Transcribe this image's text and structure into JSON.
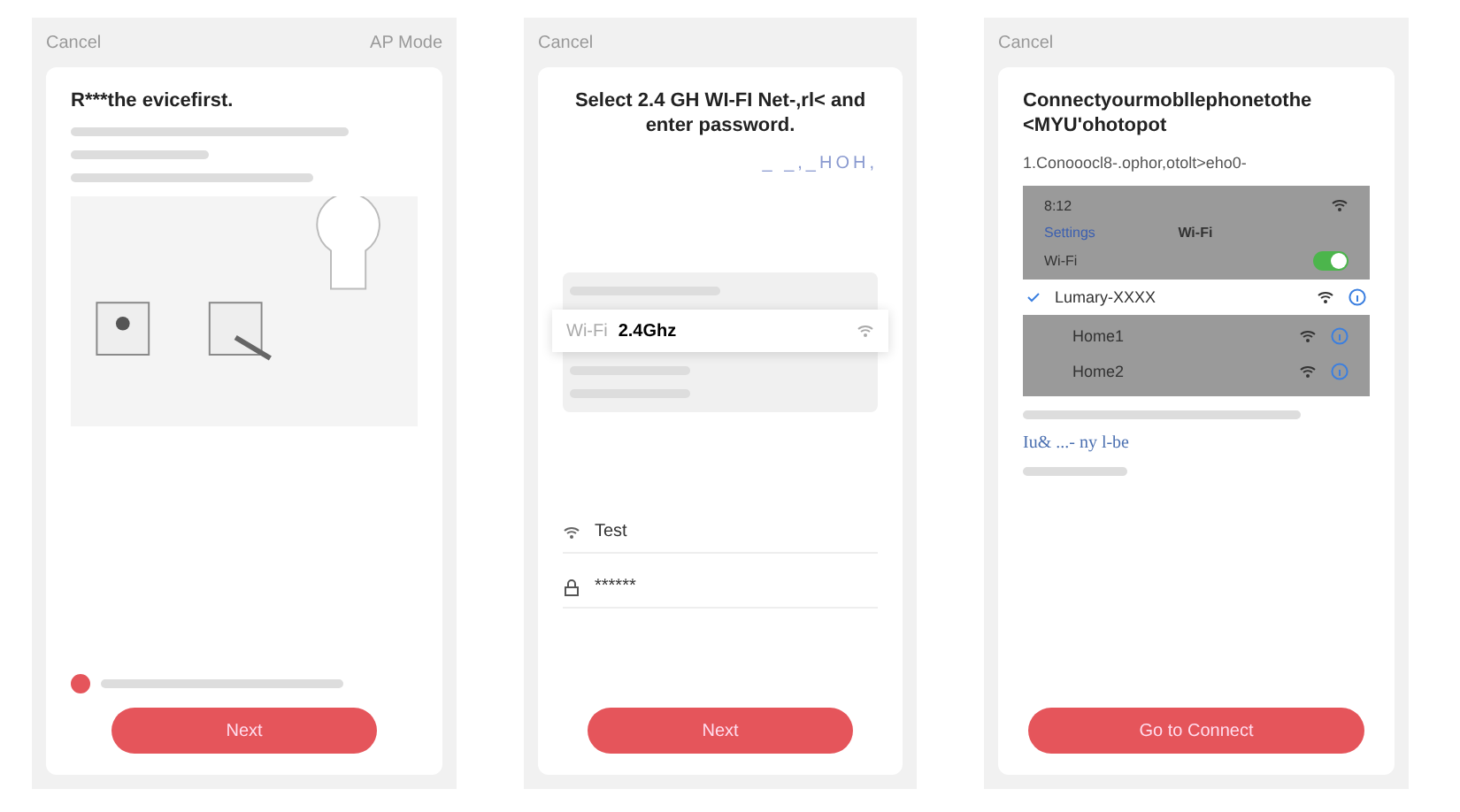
{
  "reset_screen": {
    "cancel": "Cancel",
    "mode": "AP Mode",
    "title": "R***the evicefirst.",
    "confirm_checked": true,
    "button": "Next"
  },
  "wifi_screen": {
    "cancel": "Cancel",
    "title": "Select 2.4 GH   WI-FI Net-,rl< and enter password.",
    "hint": "_ _,_HOH,",
    "networks": [
      {
        "name": "Wi-Fi",
        "band": "2.4Ghz",
        "selected": true
      }
    ],
    "ssid": "Test",
    "password": "******",
    "button": "Next"
  },
  "hotspot_screen": {
    "cancel": "Cancel",
    "title": "Connectyourmobllephonetothe <MYU'ohotopot",
    "step": "1.Conooocl8-.ophor,otolt>eho0-",
    "phone": {
      "time": "8:12",
      "back": "Settings",
      "title": "Wi-Fi",
      "toggle_label": "Wi-Fi",
      "on": true,
      "networks": [
        {
          "name": "Lumary-XXXX",
          "selected": true
        },
        {
          "name": "Home1",
          "selected": false
        },
        {
          "name": "Home2",
          "selected": false
        }
      ]
    },
    "link": "Iu& ...- ny l-be",
    "button": "Go to Connect"
  }
}
